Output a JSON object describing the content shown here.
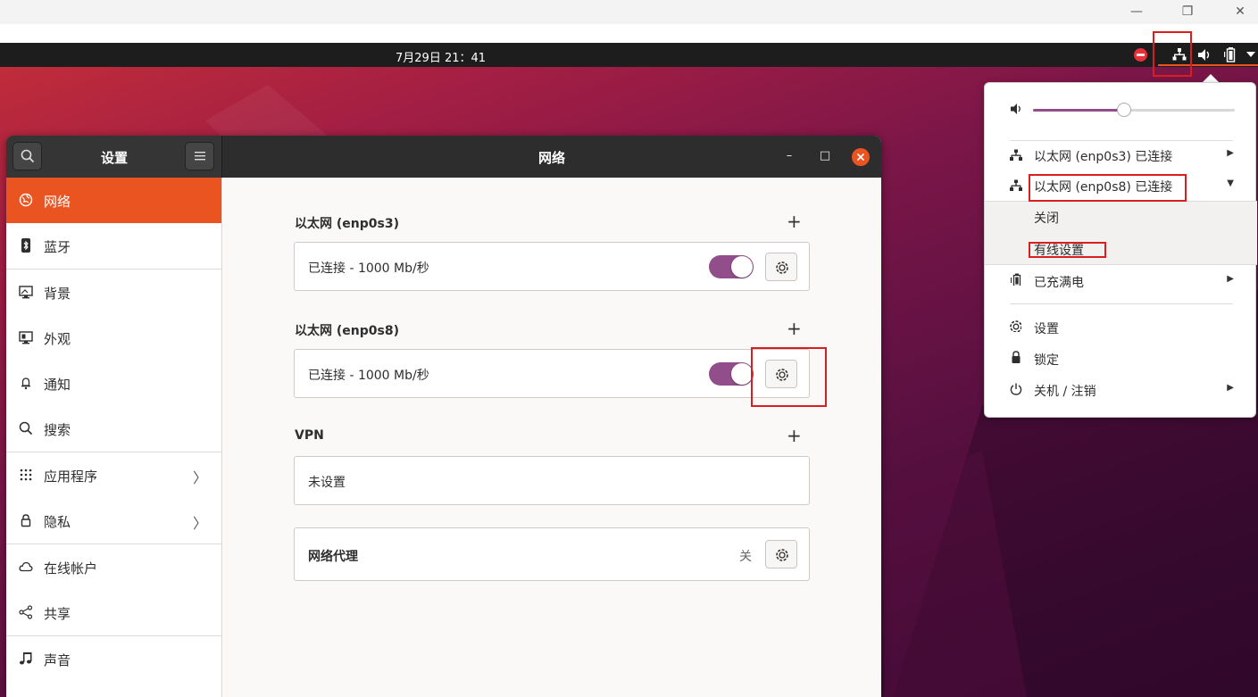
{
  "panel": {
    "clock": "7月29日  21：41",
    "host_minimize": "—",
    "host_restore": "❐",
    "host_close": "✕"
  },
  "settings": {
    "sidebar_title": "设置",
    "title": "网络",
    "win_minimize": "–",
    "win_maximize": "□",
    "sidebar": [
      {
        "label": "网络",
        "icon": "network-icon",
        "active": true
      },
      {
        "label": "蓝牙",
        "icon": "bluetooth-icon"
      },
      {
        "label": "背景",
        "icon": "background-icon"
      },
      {
        "label": "外观",
        "icon": "appearance-icon"
      },
      {
        "label": "通知",
        "icon": "bell-icon"
      },
      {
        "label": "搜索",
        "icon": "search-icon"
      },
      {
        "label": "应用程序",
        "icon": "apps-grid-icon",
        "chevron": "〉"
      },
      {
        "label": "隐私",
        "icon": "lock-icon",
        "chevron": "〉"
      },
      {
        "label": "在线帐户",
        "icon": "cloud-icon"
      },
      {
        "label": "共享",
        "icon": "share-icon"
      },
      {
        "label": "声音",
        "icon": "music-note-icon"
      }
    ],
    "sections": {
      "eth1": {
        "title": "以太网 (enp0s3)",
        "status": "已连接 - 1000 Mb/秒",
        "enabled": true
      },
      "eth2": {
        "title": "以太网 (enp0s8)",
        "status": "已连接 - 1000 Mb/秒",
        "enabled": true
      },
      "vpn": {
        "title": "VPN",
        "status": "未设置"
      },
      "proxy": {
        "title": "网络代理",
        "value": "关"
      }
    },
    "add_symbol": "+"
  },
  "sysmenu": {
    "volume_level": 0.45,
    "items": {
      "eth1": {
        "label": "以太网 (enp0s3) 已连接",
        "arrow": "▶"
      },
      "eth2": {
        "label": "以太网 (enp0s8) 已连接",
        "arrow": "▼"
      },
      "close": {
        "label": "关闭"
      },
      "wired_settings": {
        "label": "有线设置"
      },
      "battery": {
        "label": "已充满电",
        "arrow": "▶"
      },
      "settings": {
        "label": "设置"
      },
      "lock": {
        "label": "锁定"
      },
      "power": {
        "label": "关机 / 注销",
        "arrow": "▶"
      }
    }
  },
  "colors": {
    "accent": "#e95420",
    "toggle": "#924d8b",
    "annotation": "#d81e1e"
  }
}
